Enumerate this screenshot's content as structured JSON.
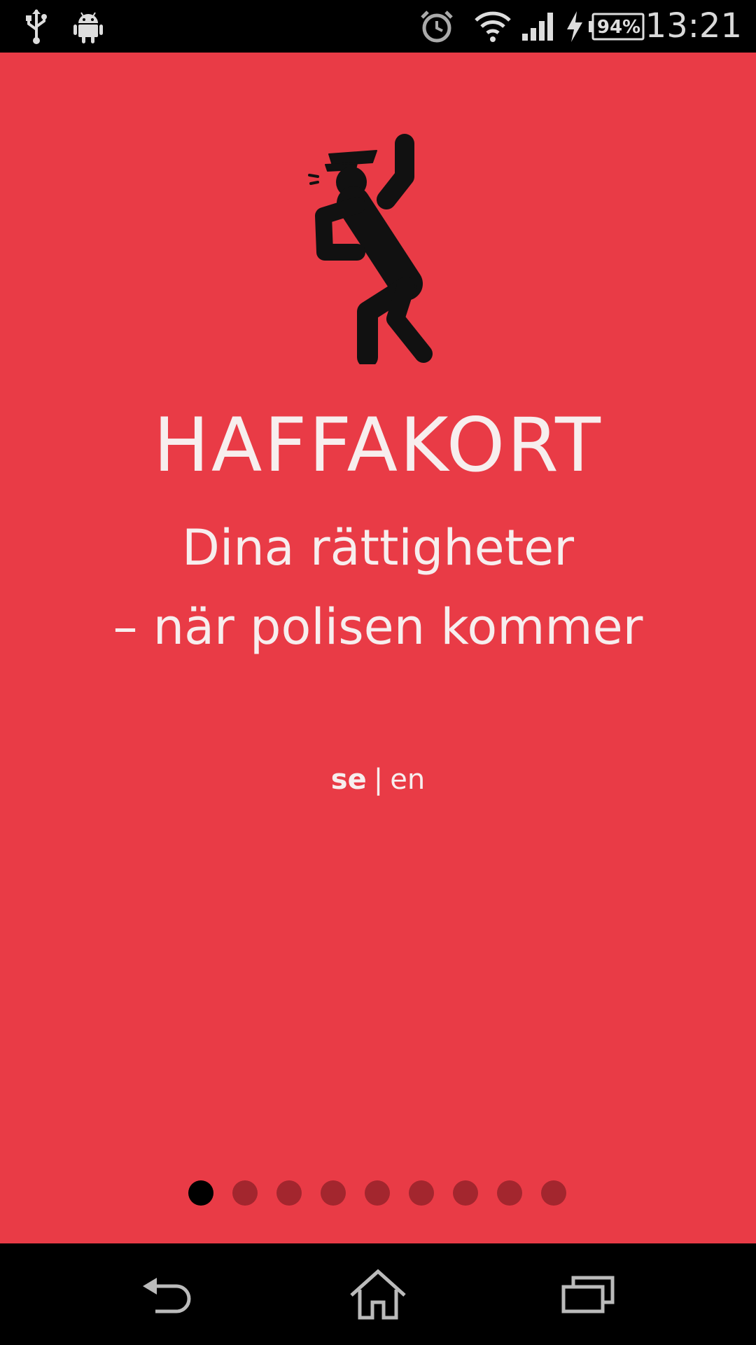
{
  "status_bar": {
    "icons_left": [
      "usb-icon",
      "android-icon"
    ],
    "icons_right": [
      "alarm-clock-icon",
      "wifi-icon",
      "signal-icon",
      "charging-icon",
      "battery-icon"
    ],
    "battery_level": "94%",
    "time": "13:21"
  },
  "intro": {
    "mascot_icon": "police-officer-whistle-icon",
    "title": "HAFFAKORT",
    "subtitle_line1": "Dina rättigheter",
    "subtitle_line2": "– när polisen kommer",
    "languages": [
      "se",
      "en"
    ],
    "selected_language": "se",
    "separator": "|"
  },
  "pager": {
    "total": 9,
    "current": 1
  },
  "nav_bar": {
    "icons": [
      "back-icon",
      "home-icon",
      "recent-apps-icon"
    ]
  },
  "colors": {
    "background": "#e93b46",
    "text": "#f7eeee",
    "dot_inactive": "#a3262e",
    "dot_active": "#000000",
    "bars": "#000000"
  }
}
